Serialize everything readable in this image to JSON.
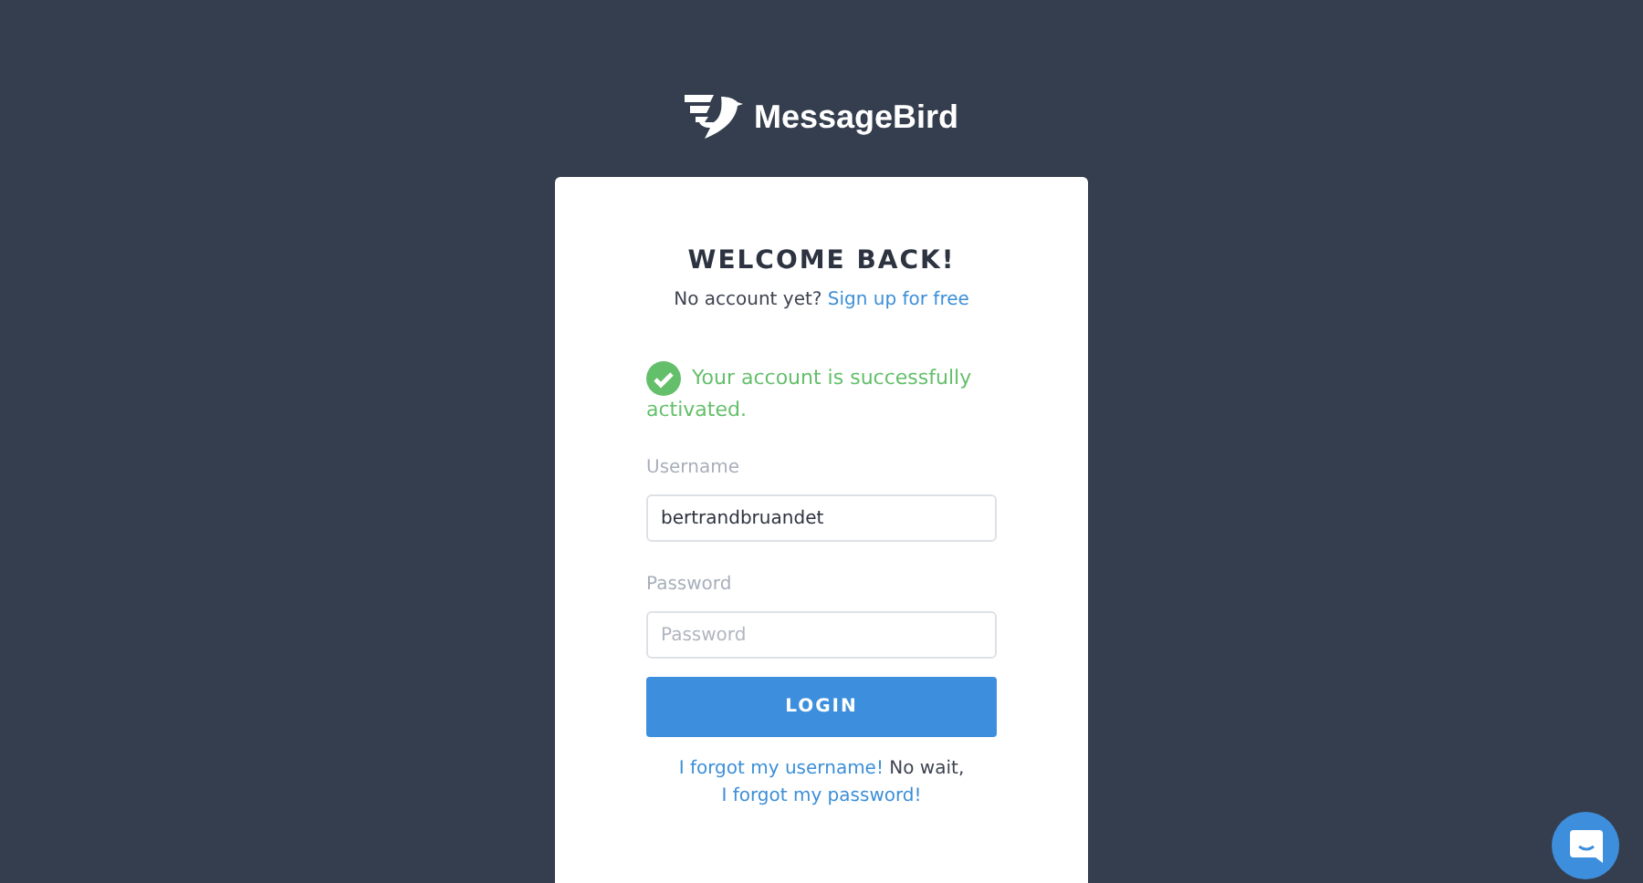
{
  "logo": {
    "text": "MessageBird"
  },
  "card": {
    "title": "WELCOME BACK!",
    "signup_prompt": "No account yet?",
    "signup_link": "Sign up for free",
    "alert": {
      "kind": "success",
      "text": "Your account is successfully activated."
    },
    "fields": [
      {
        "label": "Username",
        "value": "bertrandbruandet"
      },
      {
        "label": "Password",
        "placeholder": "Password"
      }
    ],
    "login_button": "LOGIN",
    "forgot": {
      "username_link": "I forgot my username!",
      "middle": "No wait,",
      "password_link": "I forgot my password!"
    }
  }
}
